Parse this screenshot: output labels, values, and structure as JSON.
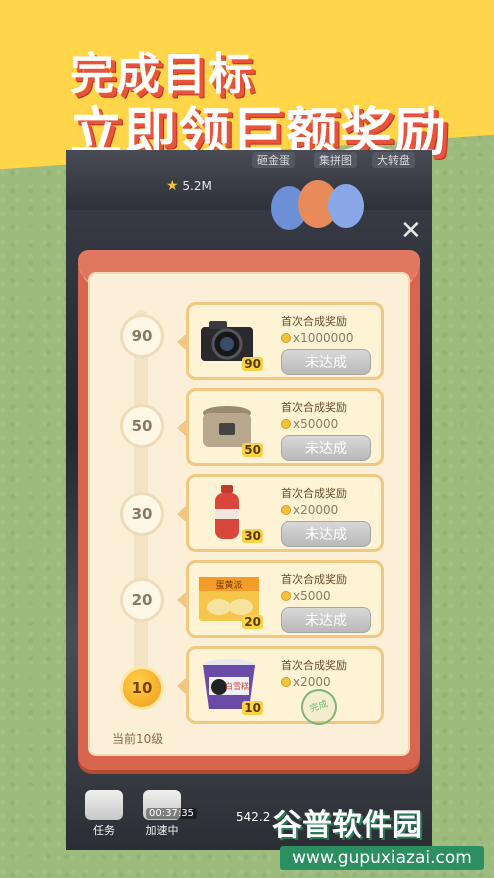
{
  "banner": {
    "line1": "完成目标",
    "line2": "立即领巨额奖励"
  },
  "game_header": {
    "tabs": [
      "砸金蛋",
      "集拼图",
      "大转盘"
    ],
    "coins": "5.2M"
  },
  "rewards_panel": {
    "milestones": [
      {
        "level": "90",
        "title": "首次合成奖励",
        "amount": "x1000000",
        "status": "未达成",
        "item_icon": "camera-icon",
        "item_level": "90"
      },
      {
        "level": "50",
        "title": "首次合成奖励",
        "amount": "x50000",
        "status": "未达成",
        "item_icon": "rice-cooker-icon",
        "item_level": "50"
      },
      {
        "level": "30",
        "title": "首次合成奖励",
        "amount": "x20000",
        "status": "未达成",
        "item_icon": "shampoo-bottle-icon",
        "item_level": "30"
      },
      {
        "level": "20",
        "title": "首次合成奖励",
        "amount": "x5000",
        "status": "未达成",
        "item_icon": "snack-box-icon",
        "item_level": "20",
        "item_label": "蛋黄派"
      },
      {
        "level": "10",
        "title": "首次合成奖励",
        "amount": "x2000",
        "status": "完成",
        "item_icon": "yogurt-cup-icon",
        "item_level": "10",
        "item_label": "白雪糕"
      }
    ],
    "current_label": "当前10级"
  },
  "bottom_bar": {
    "task_label": "任务",
    "speedup_label": "加速中",
    "timer": "00:37:35",
    "coins_partial": "542.2"
  },
  "watermark": {
    "name": "谷普软件园",
    "url": "www.gupuxiazai.com"
  },
  "colors": {
    "banner": "#ffd54a",
    "panel": "#d8664e",
    "paper": "#fbefd8",
    "button_disabled": "#c8c8c8",
    "current_node": "#f19a17",
    "watermark_green": "#2b8f62"
  }
}
